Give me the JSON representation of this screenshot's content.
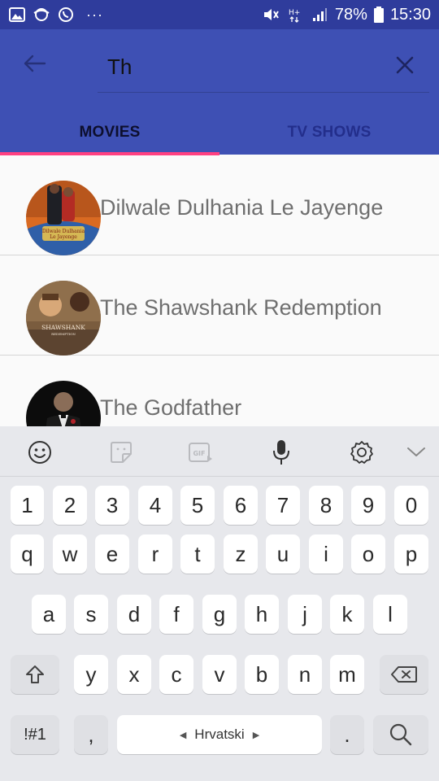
{
  "status_bar": {
    "icons_left": [
      "image-icon",
      "swap-icon",
      "whatsapp-icon"
    ],
    "more": "···",
    "battery_percent": "78%",
    "time": "15:30"
  },
  "app_bar": {
    "search_value": "Th",
    "tabs": [
      {
        "label": "MOVIES",
        "active": true
      },
      {
        "label": "TV SHOWS",
        "active": false
      }
    ],
    "accent_color": "#ff4081",
    "primary_color": "#3e50b4"
  },
  "results": [
    {
      "title": "Dilwale Dulhania Le Jayenge"
    },
    {
      "title": "The Shawshank Redemption"
    },
    {
      "title": "The Godfather"
    }
  ],
  "posters": {
    "ddlj_line1": "Dilwale Dulhania",
    "ddlj_line2": "Le Jayenge",
    "shawshank_line1": "SHAWSHANK",
    "shawshank_line2": "REDEMPTION"
  },
  "keyboard": {
    "toolbar": [
      "emoji-icon",
      "sticker-icon",
      "gif-icon",
      "microphone-icon",
      "settings-icon",
      "collapse-icon"
    ],
    "row_numbers": [
      "1",
      "2",
      "3",
      "4",
      "5",
      "6",
      "7",
      "8",
      "9",
      "0"
    ],
    "row1": [
      "q",
      "w",
      "e",
      "r",
      "t",
      "z",
      "u",
      "i",
      "o",
      "p"
    ],
    "row2": [
      "a",
      "s",
      "d",
      "f",
      "g",
      "h",
      "j",
      "k",
      "l"
    ],
    "row3": [
      "y",
      "x",
      "c",
      "v",
      "b",
      "n",
      "m"
    ],
    "symbols_key": "!#1",
    "comma_key": ",",
    "space_label": "Hrvatski",
    "period_key": "."
  }
}
